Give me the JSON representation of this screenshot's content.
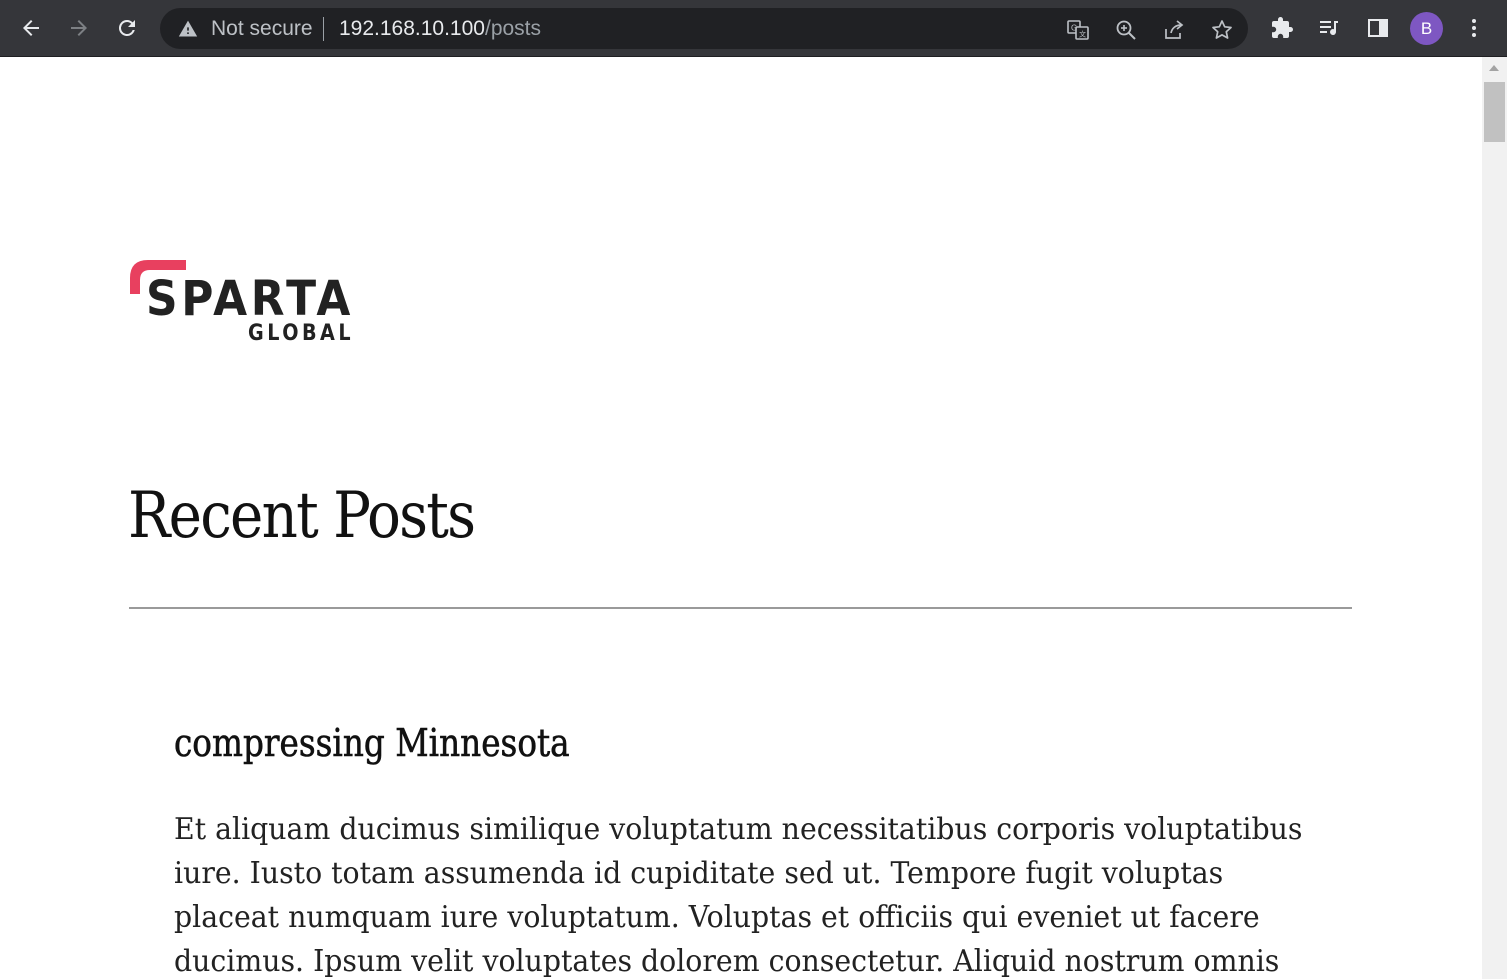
{
  "browser": {
    "security_status": "Not secure",
    "url_host": "192.168.10.100",
    "url_path": "/posts",
    "profile_initial": "B",
    "accent_color": "#7e57c2"
  },
  "page": {
    "logo": {
      "word": "SPARTA",
      "subword": "GLOBAL",
      "accent_color": "#e8405f"
    },
    "title": "Recent Posts",
    "posts": [
      {
        "title": "compressing Minnesota",
        "body": "Et aliquam ducimus similique voluptatum necessitatibus corporis voluptatibus iure. Iusto totam assumenda id cupiditate sed ut. Tempore fugit voluptas placeat numquam iure voluptatum. Voluptas et officiis qui eveniet ut facere ducimus. Ipsum velit voluptates dolorem consectetur. Aliquid nostrum omnis"
      }
    ]
  }
}
